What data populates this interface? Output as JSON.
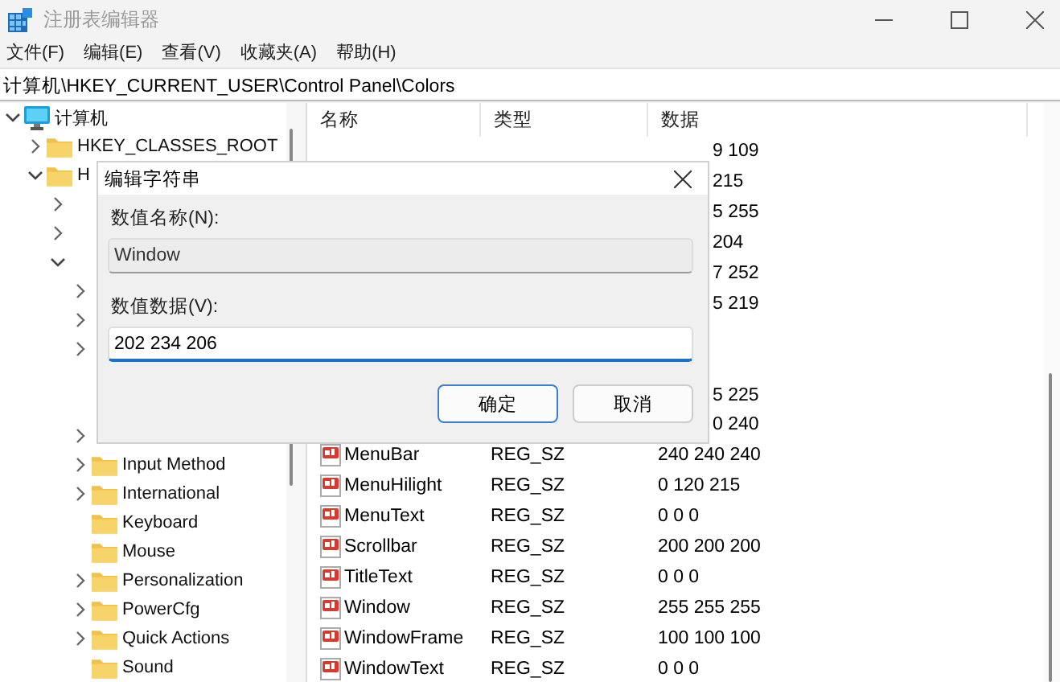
{
  "window": {
    "title": "注册表编辑器"
  },
  "menu": [
    "文件(F)",
    "编辑(E)",
    "查看(V)",
    "收藏夹(A)",
    "帮助(H)"
  ],
  "address": "计算机\\HKEY_CURRENT_USER\\Control Panel\\Colors",
  "tree": [
    {
      "label": "计算机",
      "kind": "computer",
      "expanded": true,
      "children": [
        {
          "label": "HKEY_CLASSES_ROOT",
          "expanded": false
        },
        {
          "label": "H",
          "expanded": true,
          "children": [
            {
              "kind": "covered",
              "expanded": false
            },
            {
              "kind": "covered",
              "expanded": false
            },
            {
              "kind": "covered",
              "expanded": true,
              "children": [
                {
                  "kind": "covered",
                  "expanded": false
                },
                {
                  "kind": "covered",
                  "expanded": false
                },
                {
                  "kind": "covered",
                  "expanded": false
                },
                {
                  "kind": "covered"
                },
                {
                  "kind": "covered"
                },
                {
                  "kind": "covered",
                  "expanded": false
                },
                {
                  "label": "Input Method",
                  "expanded": false
                },
                {
                  "label": "International",
                  "expanded": false
                },
                {
                  "label": "Keyboard"
                },
                {
                  "label": "Mouse"
                },
                {
                  "label": "Personalization",
                  "expanded": false
                },
                {
                  "label": "PowerCfg",
                  "expanded": false
                },
                {
                  "label": "Quick Actions",
                  "expanded": false
                },
                {
                  "label": "Sound"
                }
              ]
            }
          ]
        }
      ]
    }
  ],
  "list": {
    "columns": [
      "名称",
      "类型",
      "数据"
    ],
    "rows": [
      {
        "kind": "covered",
        "data": "9 109"
      },
      {
        "kind": "covered",
        "data": "215"
      },
      {
        "kind": "covered",
        "data": "5 255"
      },
      {
        "kind": "covered",
        "data": "204"
      },
      {
        "kind": "covered",
        "data": "7 252"
      },
      {
        "kind": "covered",
        "data": "5 219"
      },
      {
        "kind": "covered"
      },
      {
        "kind": "covered"
      },
      {
        "kind": "covered",
        "data": "5 225"
      },
      {
        "kind": "covered",
        "data": "0 240"
      },
      {
        "kind": "value",
        "name": "MenuBar",
        "type": "REG_SZ",
        "data": "240 240 240"
      },
      {
        "kind": "value",
        "name": "MenuHilight",
        "type": "REG_SZ",
        "data": "0 120 215"
      },
      {
        "kind": "value",
        "name": "MenuText",
        "type": "REG_SZ",
        "data": "0 0 0"
      },
      {
        "kind": "value",
        "name": "Scrollbar",
        "type": "REG_SZ",
        "data": "200 200 200"
      },
      {
        "kind": "value",
        "name": "TitleText",
        "type": "REG_SZ",
        "data": "0 0 0"
      },
      {
        "kind": "value",
        "name": "Window",
        "type": "REG_SZ",
        "data": "255 255 255"
      },
      {
        "kind": "value",
        "name": "WindowFrame",
        "type": "REG_SZ",
        "data": "100 100 100"
      },
      {
        "kind": "value",
        "name": "WindowText",
        "type": "REG_SZ",
        "data": "0 0 0"
      }
    ]
  },
  "dialog": {
    "title": "编辑字符串",
    "name_label": "数值名称(N):",
    "name_value": "Window",
    "data_label": "数值数据(V):",
    "data_value": "202 234 206",
    "buttons": [
      {
        "label": "确定",
        "default": true
      },
      {
        "label": "取消",
        "default": false
      }
    ]
  }
}
